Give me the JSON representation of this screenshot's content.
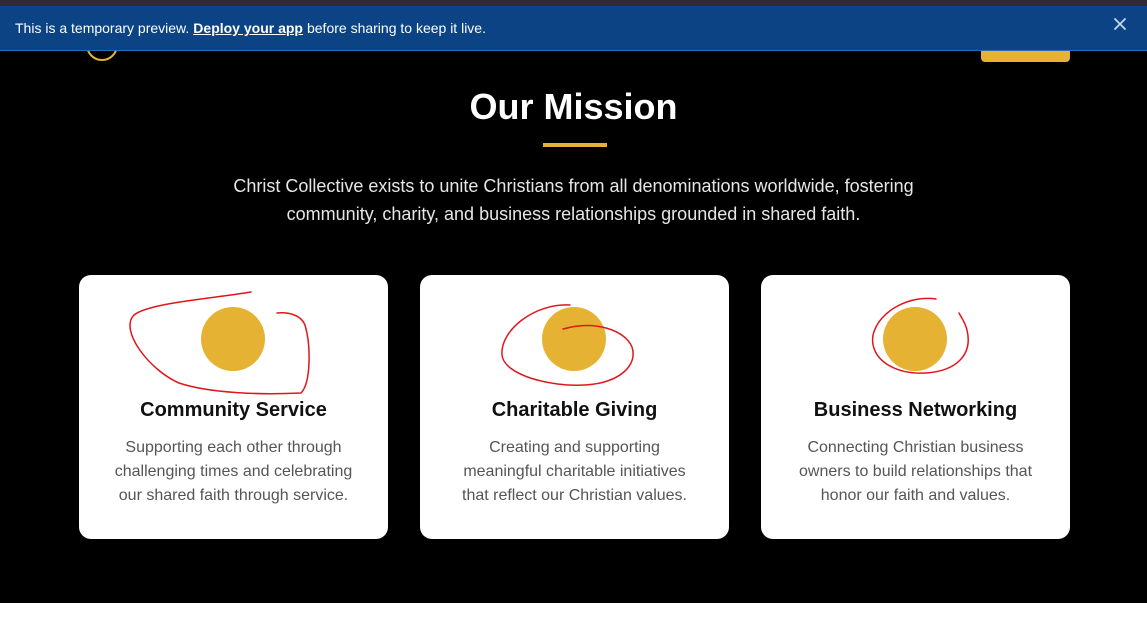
{
  "banner": {
    "prefix": "This is a temporary preview.",
    "link": "Deploy your app",
    "suffix": "before sharing to keep it live.",
    "close_icon": "close-icon"
  },
  "colors": {
    "accent": "#e5b233",
    "banner_bg": "#0b4385",
    "page_bg": "#000000",
    "card_bg": "#ffffff",
    "annotation": "#e0161b"
  },
  "mission": {
    "title": "Our Mission",
    "text": "Christ Collective exists to unite Christians from all denominations worldwide, fostering community, charity, and business relationships grounded in shared faith."
  },
  "cards": [
    {
      "title": "Community Service",
      "text": "Supporting each other through challenging times and celebrating our shared faith through service."
    },
    {
      "title": "Charitable Giving",
      "text": "Creating and supporting meaningful charitable initiatives that reflect our Christian values."
    },
    {
      "title": "Business Networking",
      "text": "Connecting Christian business owners to build relationships that honor our faith and values."
    }
  ]
}
